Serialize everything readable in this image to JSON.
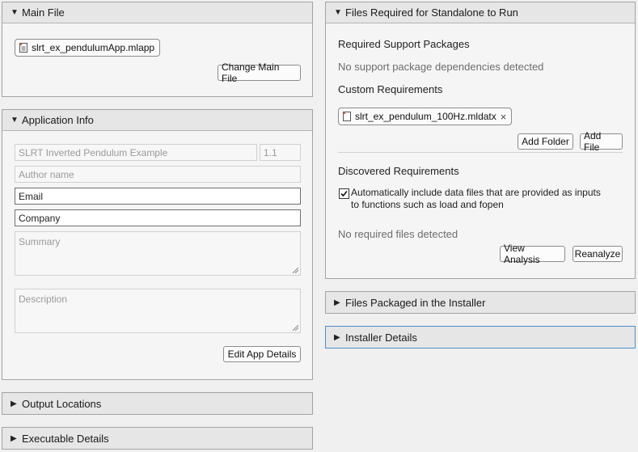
{
  "main_file": {
    "title": "Main File",
    "file_name": "slrt_ex_pendulumApp.mlapp",
    "change_button": "Change Main File"
  },
  "app_info": {
    "title": "Application Info",
    "app_name": "SLRT Inverted Pendulum Example",
    "version": "1.1",
    "author_placeholder": "Author name",
    "email_value": "Email",
    "company_value": "Company",
    "summary_placeholder": "Summary",
    "description_placeholder": "Description",
    "edit_button": "Edit App Details"
  },
  "output_locations": {
    "title": "Output Locations"
  },
  "executable_details": {
    "title": "Executable Details"
  },
  "files_required": {
    "title": "Files Required for Standalone to Run",
    "support_packages_heading": "Required Support Packages",
    "support_packages_status": "No support package dependencies detected",
    "custom_heading": "Custom Requirements",
    "custom_file": "slrt_ex_pendulum_100Hz.mldatx",
    "add_folder_button": "Add Folder",
    "add_file_button": "Add File",
    "discovered_heading": "Discovered Requirements",
    "auto_include_line1": "Automatically include data files that are provided as inputs",
    "auto_include_line2": "to functions such as load and fopen",
    "auto_include_checked": true,
    "required_status": "No required files detected",
    "view_analysis_button": "View Analysis",
    "reanalyze_button": "Reanalyze"
  },
  "files_packaged": {
    "title": "Files Packaged in the Installer"
  },
  "installer_details": {
    "title": "Installer Details"
  },
  "icons": {
    "expanded": "triangle-down-icon",
    "collapsed": "triangle-right-icon",
    "file": "file-icon",
    "remove": "close-icon",
    "check": "check-icon"
  },
  "colors": {
    "focus_border": "#4d8ec9",
    "file_icon_accent": "#d9531e"
  }
}
